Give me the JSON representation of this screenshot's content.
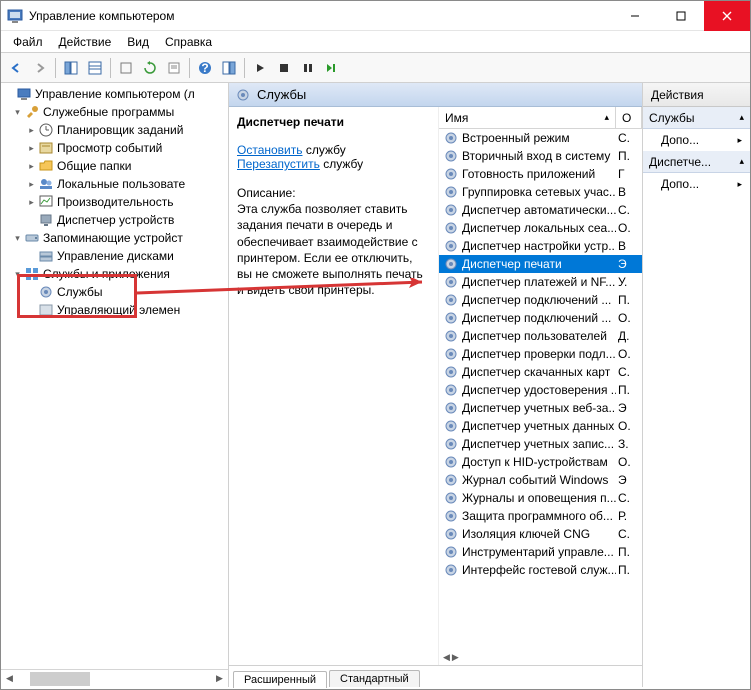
{
  "titlebar": {
    "title": "Управление компьютером"
  },
  "menu": {
    "file": "Файл",
    "action": "Действие",
    "view": "Вид",
    "help": "Справка"
  },
  "tree": {
    "root": "Управление компьютером (л",
    "n1": "Служебные программы",
    "n1a": "Планировщик заданий",
    "n1b": "Просмотр событий",
    "n1c": "Общие папки",
    "n1d": "Локальные пользовате",
    "n1e": "Производительность",
    "n1f": "Диспетчер устройств",
    "n2": "Запоминающие устройст",
    "n2a": "Управление дисками",
    "n3": "Службы и приложения",
    "n3a": "Службы",
    "n3b": "Управляющий элемен"
  },
  "center": {
    "header": "Службы",
    "detail": {
      "name": "Диспетчер печати",
      "stop": "Остановить",
      "restart": "Перезапустить",
      "suffix": "службу",
      "desc_label": "Описание:",
      "desc": "Эта служба позволяет ставить задания печати в очередь и обеспечивает взаимодействие с принтером. Если ее отключить, вы не сможете выполнять печать и видеть свои принтеры."
    },
    "columns": {
      "name": "Имя",
      "col2": "О"
    },
    "services": [
      {
        "name": "Встроенный режим",
        "c2": "С."
      },
      {
        "name": "Вторичный вход в систему",
        "c2": "П."
      },
      {
        "name": "Готовность приложений",
        "c2": "Г"
      },
      {
        "name": "Группировка сетевых учас...",
        "c2": "В"
      },
      {
        "name": "Диспетчер автоматически...",
        "c2": "С."
      },
      {
        "name": "Диспетчер локальных сеа...",
        "c2": "О."
      },
      {
        "name": "Диспетчер настройки устр...",
        "c2": "В"
      },
      {
        "name": "Диспетчер печати",
        "c2": "Э",
        "selected": true
      },
      {
        "name": "Диспетчер платежей и NF...",
        "c2": "У."
      },
      {
        "name": "Диспетчер подключений ...",
        "c2": "П."
      },
      {
        "name": "Диспетчер подключений ...",
        "c2": "О."
      },
      {
        "name": "Диспетчер пользователей",
        "c2": "Д."
      },
      {
        "name": "Диспетчер проверки подл...",
        "c2": "О."
      },
      {
        "name": "Диспетчер скачанных карт",
        "c2": "С."
      },
      {
        "name": "Диспетчер удостоверения ...",
        "c2": "П."
      },
      {
        "name": "Диспетчер учетных веб-за...",
        "c2": "Э"
      },
      {
        "name": "Диспетчер учетных данных",
        "c2": "О."
      },
      {
        "name": "Диспетчер учетных запис...",
        "c2": "З."
      },
      {
        "name": "Доступ к HID-устройствам",
        "c2": "О."
      },
      {
        "name": "Журнал событий Windows",
        "c2": "Э"
      },
      {
        "name": "Журналы и оповещения п...",
        "c2": "С."
      },
      {
        "name": "Защита программного об...",
        "c2": "Р."
      },
      {
        "name": "Изоляция ключей CNG",
        "c2": "С."
      },
      {
        "name": "Инструментарий управле...",
        "c2": "П."
      },
      {
        "name": "Интерфейс гостевой служ...",
        "c2": "П."
      }
    ],
    "tabs": {
      "extended": "Расширенный",
      "standard": "Стандартный"
    }
  },
  "actions": {
    "header": "Действия",
    "s1": "Службы",
    "i1": "Допо...",
    "s2": "Диспетче...",
    "i2": "Допо..."
  }
}
